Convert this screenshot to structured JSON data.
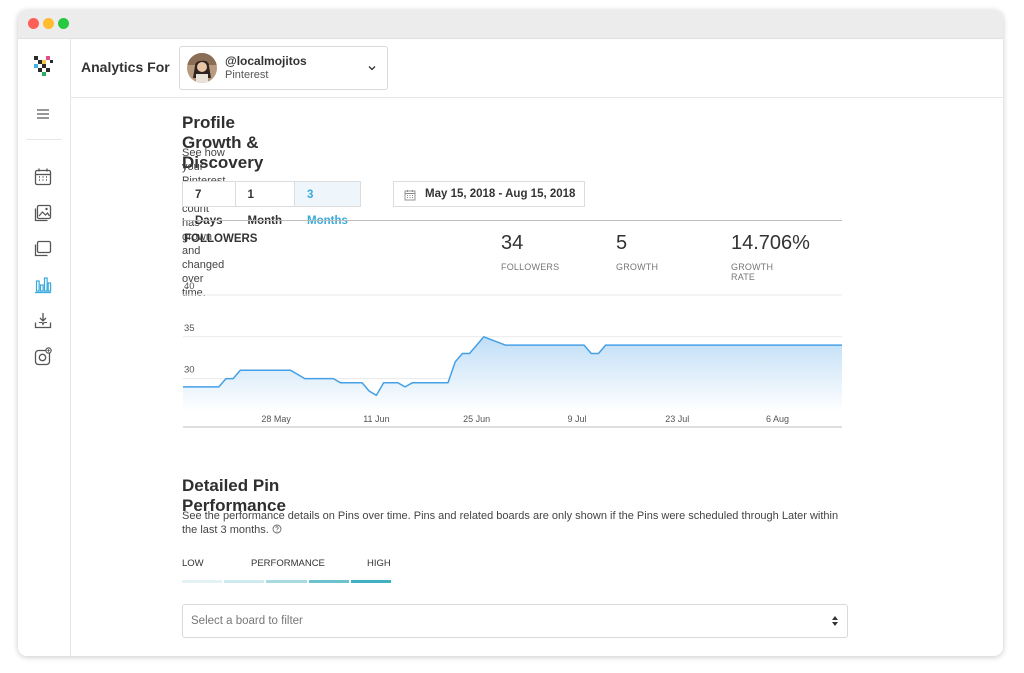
{
  "header": {
    "analytics_for": "Analytics For",
    "account": {
      "handle": "@localmojitos",
      "network": "Pinterest"
    }
  },
  "sidebar": {
    "icons": [
      "menu-icon",
      "calendar-icon",
      "media-library-icon",
      "conversations-icon",
      "analytics-icon",
      "download-icon",
      "instagram-icon"
    ],
    "active": "analytics-icon"
  },
  "growth": {
    "title": "Profile Growth & Discovery",
    "description": "See how your Pinterest follower count has grown and changed over time.",
    "ranges": [
      "7 Days",
      "1 Month",
      "3 Months"
    ],
    "active_range": "3 Months",
    "date_range": "May 15, 2018 - Aug 15, 2018",
    "chart_title": "FOLLOWERS",
    "stats": [
      {
        "value": "34",
        "label": "FOLLOWERS"
      },
      {
        "value": "5",
        "label": "GROWTH"
      },
      {
        "value": "14.706%",
        "label": "GROWTH RATE"
      }
    ]
  },
  "chart_data": {
    "type": "area",
    "title": "FOLLOWERS",
    "x_tick_labels": [
      "28 May",
      "11 Jun",
      "25 Jun",
      "9 Jul",
      "23 Jul",
      "6 Aug"
    ],
    "y_ticks": [
      30,
      35,
      40
    ],
    "ylim": [
      26,
      40
    ],
    "xlim": [
      "2018-05-15",
      "2018-08-15"
    ],
    "grid": true,
    "series": [
      {
        "x": [
          "2018-05-15",
          "2018-05-18",
          "2018-05-20",
          "2018-05-21",
          "2018-05-22",
          "2018-05-23",
          "2018-05-24",
          "2018-05-30",
          "2018-06-01",
          "2018-06-02",
          "2018-06-05",
          "2018-06-06",
          "2018-06-07",
          "2018-06-09",
          "2018-06-10",
          "2018-06-11",
          "2018-06-12",
          "2018-06-14",
          "2018-06-15",
          "2018-06-16",
          "2018-06-17",
          "2018-06-21",
          "2018-06-22",
          "2018-06-23",
          "2018-06-24",
          "2018-06-25",
          "2018-06-26",
          "2018-06-29",
          "2018-06-30",
          "2018-07-01",
          "2018-07-10",
          "2018-07-11",
          "2018-07-12",
          "2018-07-13",
          "2018-08-15"
        ],
        "values": [
          29,
          29,
          29,
          30,
          30,
          31,
          31,
          31,
          30,
          30,
          30,
          29.5,
          29.5,
          29.5,
          28.5,
          28,
          29.5,
          29.5,
          29,
          29.5,
          29.5,
          29.5,
          32,
          33,
          33,
          34,
          35,
          34,
          34,
          34,
          34,
          33,
          33,
          34,
          34
        ]
      }
    ],
    "colors": {
      "line": "#46a0e6",
      "fill_top": "#bcdcf6",
      "fill_bottom": "#ffffff"
    }
  },
  "pins": {
    "title": "Detailed Pin Performance",
    "description": "See the performance details on Pins over time. Pins and related boards are only shown if the Pins were scheduled through Later within the last 3 months.",
    "perf_low": "LOW",
    "perf_mid": "PERFORMANCE",
    "perf_high": "HIGH",
    "filter_placeholder": "Select a board to filter"
  },
  "colors": {
    "accent": "#39a9dc",
    "perf_bar": [
      "#e3f3f5",
      "#cfeaee",
      "#a7dae1",
      "#6cc3cf",
      "#41b2c1"
    ]
  }
}
